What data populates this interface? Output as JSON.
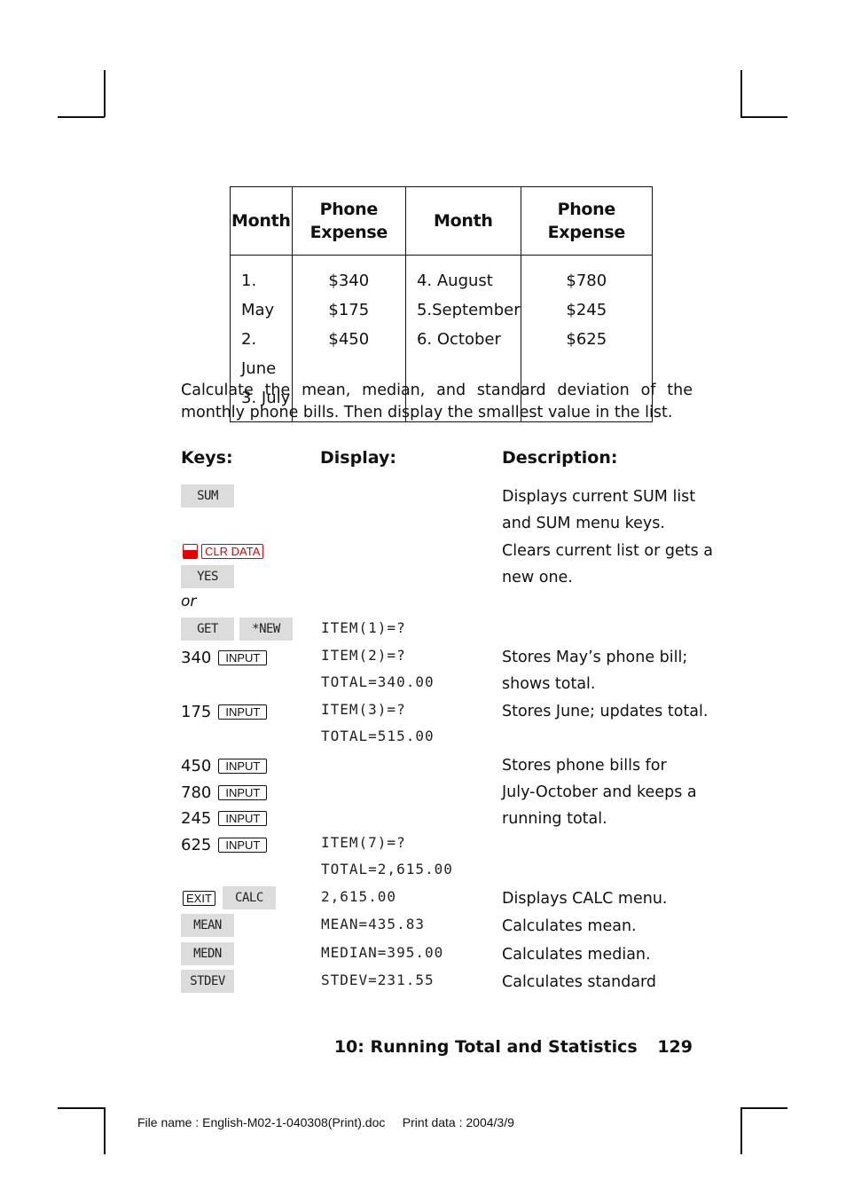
{
  "table": {
    "headers": [
      "Month",
      "Phone Expense",
      "Month",
      "Phone Expense"
    ],
    "rows_left": [
      {
        "month": "1. May",
        "expense": "$340"
      },
      {
        "month": "2. June",
        "expense": "$175"
      },
      {
        "month": "3. July",
        "expense": "$450"
      }
    ],
    "rows_right": [
      {
        "month": "4. August",
        "expense": "$780"
      },
      {
        "month": "5.September",
        "expense": "$245"
      },
      {
        "month": "6. October",
        "expense": "$625"
      }
    ]
  },
  "intro": "Calculate the mean, median, and standard deviation of the monthly phone bills. Then display the smallest value in the list.",
  "columns": {
    "keys": "Keys:",
    "display": "Display:",
    "description": "Description:"
  },
  "steps": {
    "sum": "SUM",
    "sum_desc_1": "Displays current SUM list",
    "sum_desc_2": "and SUM menu keys.",
    "clr_data": "CLR DATA",
    "clr_desc_1": "Clears current list or gets a",
    "clr_desc_2": "new one.",
    "yes": "YES",
    "or": "or",
    "get": "GET",
    "new": "*NEW",
    "item1": "ITEM(1)=?",
    "input_label": "INPUT",
    "v340": "340",
    "item2": "ITEM(2)=?",
    "total340": "TOTAL=340.00",
    "desc340_1": "Stores May’s phone bill;",
    "desc340_2": "shows total.",
    "v175": "175",
    "item3": "ITEM(3)=?",
    "total515": "TOTAL=515.00",
    "desc175": "Stores June; updates total.",
    "v450": "450",
    "v780": "780",
    "v245": "245",
    "v625": "625",
    "desc_rest_1": "Stores phone bills for",
    "desc_rest_2": "July-October and keeps a",
    "desc_rest_3": "running total.",
    "item7": "ITEM(7)=?",
    "total2615": "TOTAL=2,615.00",
    "exit": "EXIT",
    "calc": "CALC",
    "calc_display": "2,615.00",
    "calc_desc": "Displays CALC menu.",
    "mean": "MEAN",
    "mean_display": "MEAN=435.83",
    "mean_desc": "Calculates mean.",
    "medn": "MEDN",
    "medn_display": "MEDIAN=395.00",
    "medn_desc": "Calculates median.",
    "stdev": "STDEV",
    "stdev_display": "STDEV=231.55",
    "stdev_desc": "Calculates standard"
  },
  "footer": {
    "chapter": "10: Running Total and Statistics",
    "page": "129"
  },
  "file_info": "File name : English-M02-1-040308(Print).doc     Print data : 2004/3/9"
}
